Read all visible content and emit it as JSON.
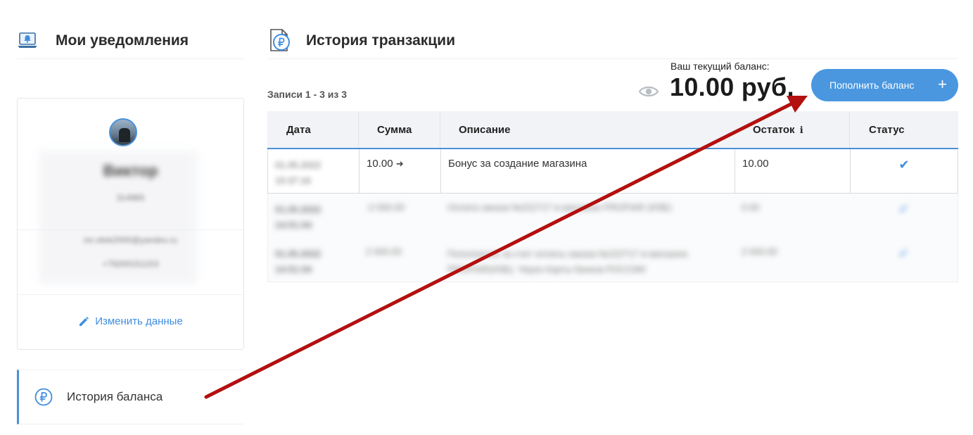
{
  "sidebar": {
    "notifications_title": "Мои уведомления",
    "profile": {
      "name": "Виктор",
      "id": "314965",
      "email": "mr.vitek2000@yandex.ru",
      "phone": "+79200151153",
      "edit_label": "Изменить данные"
    },
    "menu": {
      "balance_history_label": "История баланса"
    }
  },
  "main": {
    "title": "История транзакции",
    "records_label": "Записи 1 - 3 из 3",
    "balance_label": "Ваш текущий баланс:",
    "balance_amount": "10.00 руб.",
    "topup_label": "Пополнить баланс",
    "table": {
      "headers": {
        "date": "Дата",
        "amount": "Сумма",
        "description": "Описание",
        "remainder": "Остаток",
        "status": "Статус"
      },
      "rows": [
        {
          "date": "01.05.2022 15:37:16",
          "amount": "10.00",
          "description": "Бонус за создание магазина",
          "remainder": "10.00",
          "status": "✔"
        },
        {
          "date": "01.05.2022 14:51:04",
          "amount": "-2 000.00",
          "description": "Оплата заказа №222717 в магазине PROPIAR (ИЗБ)",
          "remainder": "0.00",
          "status": "✔"
        },
        {
          "date": "01.05.2022 14:51:04",
          "amount": "2 000.00",
          "description": "Пополнение за счет оплаты заказа №222717 в магазине PROPIAR(ИЗБ). Через Карты банков РОССИИ",
          "remainder": "2 000.00",
          "status": "✔"
        }
      ]
    }
  },
  "colors": {
    "accent": "#4a90d9",
    "button": "#4a97e0",
    "arrow": "#b31010"
  }
}
